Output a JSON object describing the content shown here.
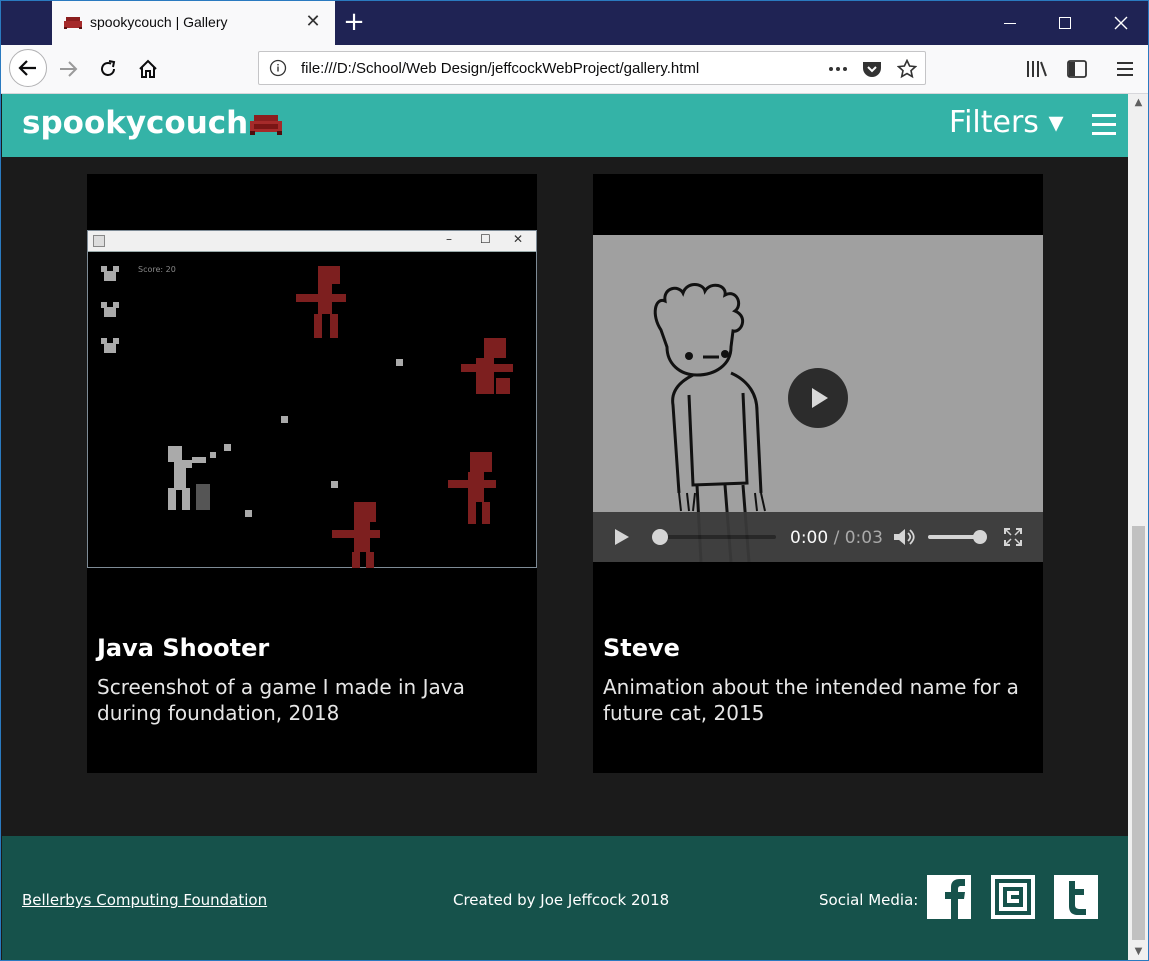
{
  "browser": {
    "tab_title": "spookycouch | Gallery",
    "url": "file:///D:/School/Web Design/jeffcockWebProject/gallery.html",
    "tab_close": "✕",
    "new_tab": "+"
  },
  "header": {
    "logo": "spookycouch",
    "filters_label": "Filters ▾"
  },
  "gallery": {
    "items": [
      {
        "title": "Java Shooter",
        "description": "Screenshot of a game I made in Java during foundation, 2018",
        "score_text": "Score: 20"
      },
      {
        "title": "Steve",
        "description": "Animation about the intended name for a future cat, 2015",
        "time_current": "0:00",
        "time_duration": " / 0:03"
      }
    ]
  },
  "footer": {
    "link": "Bellerbys Computing Foundation",
    "credit": "Created by Joe Jeffcock 2018",
    "social_label": "Social Media:"
  },
  "colors": {
    "header_bg": "#34b3a7",
    "footer_bg": "#16524b",
    "page_bg": "#1b1b1b",
    "tab_strip": "#1f2354"
  }
}
